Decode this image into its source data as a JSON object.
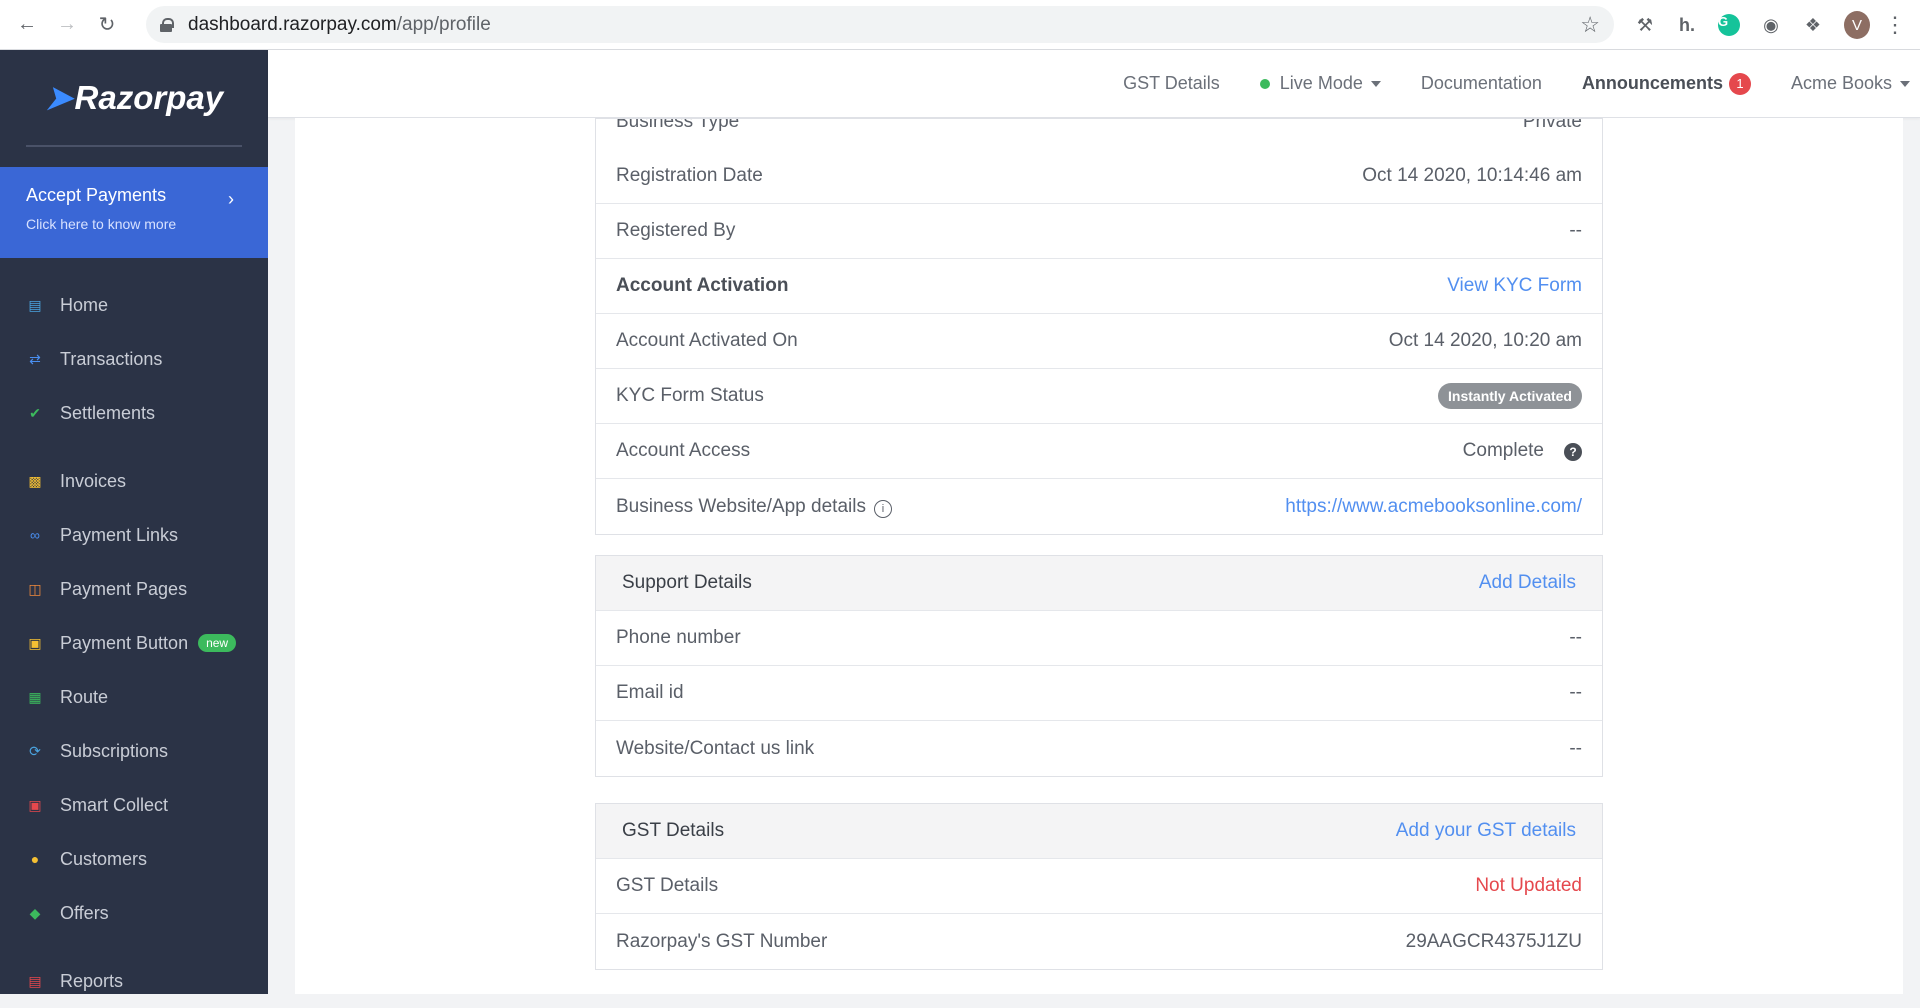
{
  "browser": {
    "url_host": "dashboard.razorpay.com",
    "url_path": "/app/profile",
    "profile_initial": "V"
  },
  "sidebar": {
    "logo": "Razorpay",
    "promo": {
      "title": "Accept Payments",
      "subtitle": "Click here to know more"
    },
    "items": [
      {
        "label": "Home",
        "icon": "home-chart-icon",
        "color": "#4aa3df"
      },
      {
        "label": "Transactions",
        "icon": "transactions-icon",
        "color": "#4a8ff0"
      },
      {
        "label": "Settlements",
        "icon": "settlements-check-icon",
        "color": "#3cba5d"
      },
      {
        "label": "Invoices",
        "icon": "invoice-icon",
        "color": "#f5c033"
      },
      {
        "label": "Payment Links",
        "icon": "link-icon",
        "color": "#4a8ff0"
      },
      {
        "label": "Payment Pages",
        "icon": "pages-icon",
        "color": "#f08a3c"
      },
      {
        "label": "Payment Button",
        "icon": "pay-button-icon",
        "color": "#f5c033",
        "badge": "new"
      },
      {
        "label": "Route",
        "icon": "route-store-icon",
        "color": "#3cba5d"
      },
      {
        "label": "Subscriptions",
        "icon": "subscriptions-icon",
        "color": "#4aa3df"
      },
      {
        "label": "Smart Collect",
        "icon": "bank-icon",
        "color": "#e5484d"
      },
      {
        "label": "Customers",
        "icon": "customers-icon",
        "color": "#f5c033"
      },
      {
        "label": "Offers",
        "icon": "offers-tag-icon",
        "color": "#3cba5d"
      },
      {
        "label": "Reports",
        "icon": "reports-icon",
        "color": "#e5484d"
      }
    ]
  },
  "header": {
    "gst": "GST Details",
    "mode": "Live Mode",
    "docs": "Documentation",
    "announcements": "Announcements",
    "announcements_count": "1",
    "account": "Acme Books"
  },
  "account": {
    "partial_label": "Business Type",
    "partial_value": "Private",
    "rows": {
      "reg_date_label": "Registration Date",
      "reg_date_value": "Oct 14 2020, 10:14:46 am",
      "reg_by_label": "Registered By",
      "reg_by_value": "--",
      "activation_label": "Account Activation",
      "activation_link": "View KYC Form",
      "activated_on_label": "Account Activated On",
      "activated_on_value": "Oct 14 2020, 10:20 am",
      "kyc_label": "KYC Form Status",
      "kyc_value": "Instantly Activated",
      "access_label": "Account Access",
      "access_value": "Complete",
      "website_label": "Business Website/App details",
      "website_value": "https://www.acmebooksonline.com/"
    }
  },
  "support": {
    "title": "Support Details",
    "action": "Add Details",
    "phone_label": "Phone number",
    "phone_value": "--",
    "email_label": "Email id",
    "email_value": "--",
    "contact_label": "Website/Contact us link",
    "contact_value": "--"
  },
  "gst": {
    "title": "GST Details",
    "action": "Add your GST details",
    "details_label": "GST Details",
    "details_value": "Not Updated",
    "number_label": "Razorpay's GST Number",
    "number_value": "29AAGCR4375J1ZU"
  }
}
